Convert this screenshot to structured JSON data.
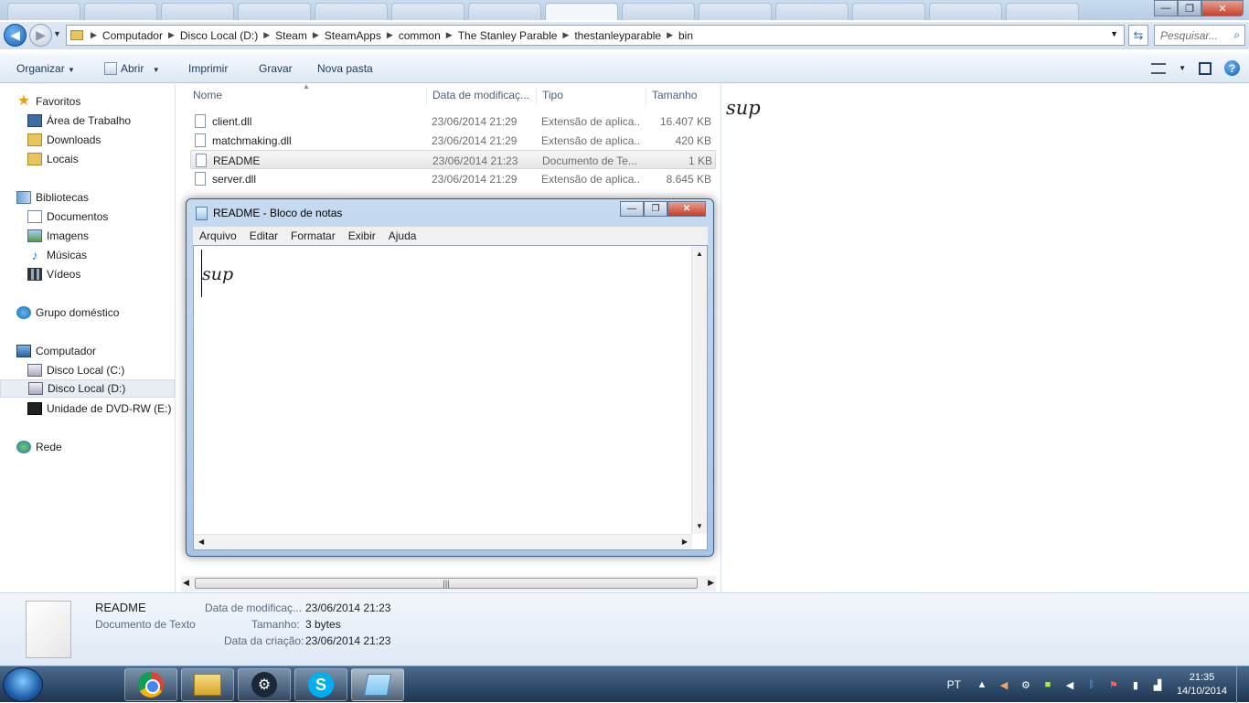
{
  "window": {
    "minimize": "—",
    "maximize": "❐",
    "close": "✕"
  },
  "address": {
    "crumbs": [
      "Computador",
      "Disco Local (D:)",
      "Steam",
      "SteamApps",
      "common",
      "The Stanley Parable",
      "thestanleyparable",
      "bin"
    ],
    "search_placeholder": "Pesquisar..."
  },
  "toolbar": {
    "organize": "Organizar",
    "open": "Abrir",
    "print": "Imprimir",
    "burn": "Gravar",
    "new_folder": "Nova pasta"
  },
  "sidebar": {
    "favorites": "Favoritos",
    "desktop": "Área de Trabalho",
    "downloads": "Downloads",
    "places": "Locais",
    "libraries": "Bibliotecas",
    "documents": "Documentos",
    "images": "Imagens",
    "music": "Músicas",
    "videos": "Vídeos",
    "homegroup": "Grupo doméstico",
    "computer": "Computador",
    "drive_c": "Disco Local (C:)",
    "drive_d": "Disco Local (D:)",
    "dvd": "Unidade de DVD-RW (E:) N",
    "network": "Rede"
  },
  "columns": {
    "name": "Nome",
    "date": "Data de modificaç...",
    "type": "Tipo",
    "size": "Tamanho"
  },
  "files": [
    {
      "name": "client.dll",
      "date": "23/06/2014 21:29",
      "type": "Extensão de aplica...",
      "size": "16.407 KB"
    },
    {
      "name": "matchmaking.dll",
      "date": "23/06/2014 21:29",
      "type": "Extensão de aplica...",
      "size": "420 KB"
    },
    {
      "name": "README",
      "date": "23/06/2014 21:23",
      "type": "Documento de Te...",
      "size": "1 KB"
    },
    {
      "name": "server.dll",
      "date": "23/06/2014 21:29",
      "type": "Extensão de aplica...",
      "size": "8.645 KB"
    }
  ],
  "preview": {
    "text": "sup"
  },
  "details": {
    "name": "README",
    "kind": "Documento de Texto",
    "modified_label": "Data de modificaç...",
    "modified_value": "23/06/2014 21:23",
    "size_label": "Tamanho:",
    "size_value": "3 bytes",
    "created_label": "Data da criação:",
    "created_value": "23/06/2014 21:23"
  },
  "notepad": {
    "title": "README - Bloco de notas",
    "menu": [
      "Arquivo",
      "Editar",
      "Formatar",
      "Exibir",
      "Ajuda"
    ],
    "content": "sup"
  },
  "taskbar": {
    "lang": "PT",
    "time": "21:35",
    "date": "14/10/2014",
    "apps": [
      "chrome-icon",
      "explorer-icon",
      "steam-icon",
      "skype-icon",
      "notepad-icon"
    ]
  }
}
